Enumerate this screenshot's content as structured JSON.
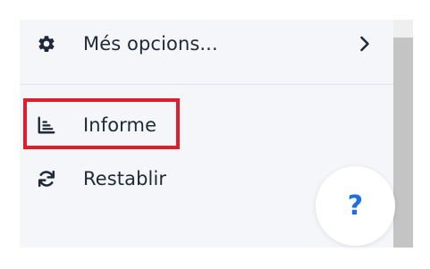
{
  "menu": {
    "items": [
      {
        "label": "Més opcions...",
        "icon": "gear-icon",
        "has_submenu": true,
        "submenu_icon": "chevron-right-icon"
      },
      {
        "label": "Informe",
        "icon": "bar-chart-icon",
        "has_submenu": false
      },
      {
        "label": "Restablir",
        "icon": "refresh-icon",
        "has_submenu": false
      }
    ]
  },
  "help_button": {
    "label": "?"
  },
  "colors": {
    "panel_bg": "#f5f6fa",
    "text": "#1f2937",
    "highlight": "#e01e2b",
    "help_accent": "#1f6fe0",
    "scrollbar": "#c4c4c4"
  }
}
